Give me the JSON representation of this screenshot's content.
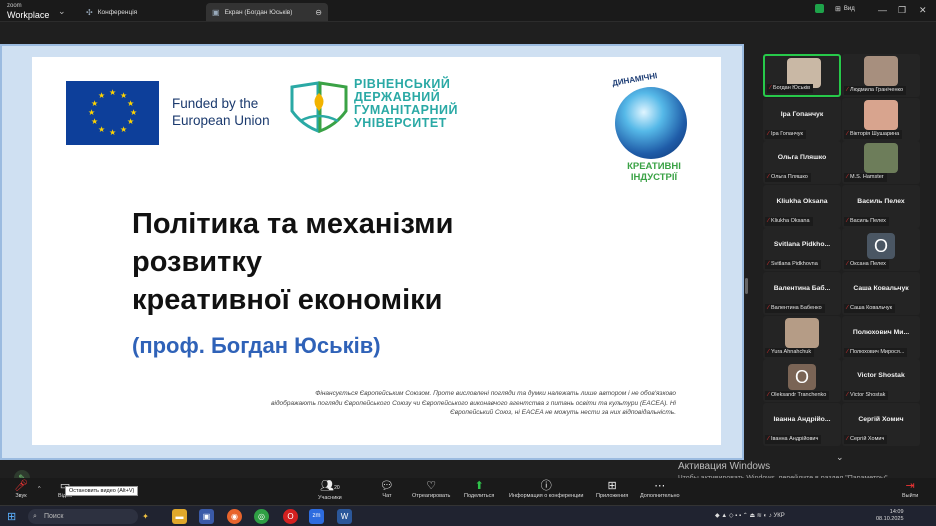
{
  "app": {
    "brand_small": "zoom",
    "brand_large": "Workplace"
  },
  "tabs": {
    "conference": "Конференція",
    "screen": "Екран (Богдан Юськів)"
  },
  "view_label": "Вид",
  "slide": {
    "funded_line1": "Funded by the",
    "funded_line2": "European Union",
    "univ_line1": "РІВНЕНСЬКИЙ",
    "univ_line2": "ДЕРЖАВНИЙ",
    "univ_line3": "ГУМАНІТАРНИЙ",
    "univ_line4": "УНІВЕРСИТЕТ",
    "dyn": "ДИНАМІЧНІ",
    "kreat_line1": "КРЕАТИВНІ",
    "kreat_line2": "ІНДУСТРІЇ",
    "title_line1": "Політика та механізми",
    "title_line2": "розвитку",
    "title_line3": "креативної економіки",
    "author": "(проф. Богдан Юськів)",
    "disclaimer": "Фінансується Європейським Союзом. Проте висловлені погляди та думки належать лише автором і не обов'язково відображають погляди Європейського Союзу чи Європейського виконавчого агентства з питань освіти та культури (EACEA). Ні Європейський Союз, ні EACEA не можуть нести за них відповідальність."
  },
  "participants": [
    {
      "name": "",
      "label": "Богдан Юськів",
      "video": true
    },
    {
      "name": "",
      "label": "Людмила Граніченко",
      "video": true
    },
    {
      "name": "Іра Гопанчук",
      "label": "Іра Гопанчук"
    },
    {
      "name": "",
      "label": "Вікторія Шушарина",
      "video": true
    },
    {
      "name": "Ольга Пляшко",
      "label": "Ольга Пляшко"
    },
    {
      "name": "",
      "label": "M.S. Hamster",
      "video": true
    },
    {
      "name": "Kliukha Oksana",
      "label": "Kliukha Oksana"
    },
    {
      "name": "Василь Пелех",
      "label": "Василь Пелех"
    },
    {
      "name": "Svitlana Pidkho...",
      "label": "Svitlana Pidkhovna"
    },
    {
      "name": "",
      "label": "Оксана Пелех",
      "letter": "O"
    },
    {
      "name": "Валентина Баб...",
      "label": "Валентина Бабенко"
    },
    {
      "name": "Саша Ковальчук",
      "label": "Саша Ковальчук"
    },
    {
      "name": "",
      "label": "Yura Ahnahchuk",
      "video": true
    },
    {
      "name": "Полюхович Ми...",
      "label": "Полюхович Мирося..."
    },
    {
      "name": "",
      "label": "Oleksandr Tranchenko",
      "letter": "O"
    },
    {
      "name": "Victor Shostak",
      "label": "Victor Shostak"
    },
    {
      "name": "Іванна Андрійо...",
      "label": "Іванна Андрійович"
    },
    {
      "name": "Сергій Хомич",
      "label": "Сергій Хомич"
    }
  ],
  "watermark": {
    "line1": "Активация Windows",
    "line2": "Чтобы активировать Windows, перейдите в раздел \"Параметры\"."
  },
  "toolbar": {
    "audio": "Звук",
    "video": "Відео",
    "video_tooltip": "Остановить видео (Alt+V)",
    "participants": "Учасники",
    "participants_count": "20",
    "chat": "Чат",
    "react": "Отреагировать",
    "share": "Поделиться",
    "info": "Информация о конференции",
    "apps": "Приложения",
    "more": "Дополнительно",
    "leave": "Выйти"
  },
  "taskbar": {
    "search_placeholder": "Поиск",
    "lang": "УКР",
    "time": "14:09",
    "date": "08.10.2025"
  },
  "colors": {
    "accent": "#2fc24a",
    "mic_muted": "#e33333",
    "slide_blue": "#2f62b8"
  }
}
